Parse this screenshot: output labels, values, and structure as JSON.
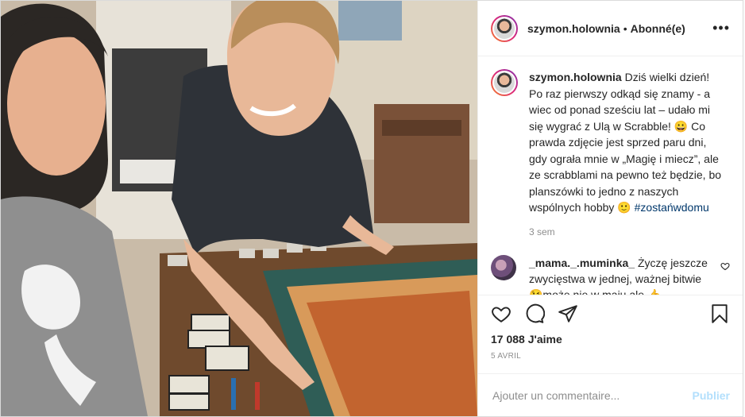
{
  "header": {
    "username": "szymon.holownia",
    "separator": "•",
    "follow_label": "Abonné(e)",
    "more_label": "•••"
  },
  "caption": {
    "username": "szymon.holownia",
    "text": "Dziś wielki dzień! Po raz pierwszy odkąd się znamy - a wiec od ponad sześciu lat – udało mi się wygrać z Ulą w Scrabble! 😀 Co prawda zdjęcie jest sprzed paru dni, gdy ograła mnie w „Magię i miecz”, ale ze scrabblami na pewno też będzie, bo planszówki to jedno z naszych wspólnych hobby 🙂",
    "hashtag": "#zostańwdomu",
    "age": "3 sem"
  },
  "comment": {
    "username": "_mama._.muminka_",
    "text": "Życzę jeszcze zwycięstwa w jednej, ważnej bitwie😘może nie w maju ale 👍"
  },
  "likes": "17 088 J'aime",
  "date": "5 AVRIL",
  "add_comment": {
    "placeholder": "Ajouter un commentaire...",
    "publish_label": "Publier"
  },
  "colors": {
    "link": "#00376b",
    "publish_disabled": "#b2dffc",
    "secondary_text": "#8e8e8e",
    "border": "#dbdbdb"
  },
  "icons": [
    "heart-icon",
    "comment-icon",
    "share-icon",
    "bookmark-icon",
    "more-icon"
  ]
}
